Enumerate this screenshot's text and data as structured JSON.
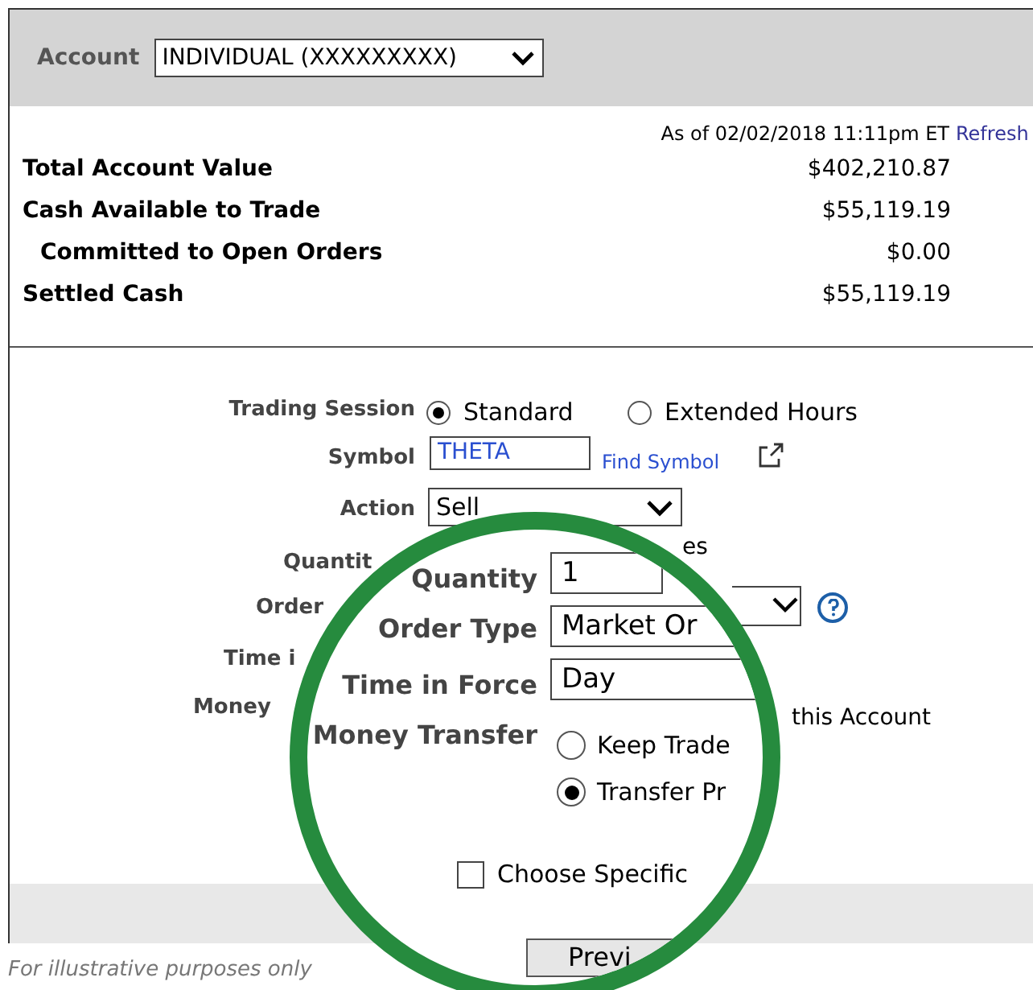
{
  "account": {
    "label": "Account",
    "value": "INDIVIDUAL (XXXXXXXXX)"
  },
  "balances": {
    "as_of": "As of 02/02/2018 11:11pm ET",
    "refresh": "Refresh",
    "rows": [
      {
        "label": "Total Account Value",
        "value": "$402,210.87",
        "indented": false
      },
      {
        "label": "Cash Available to Trade",
        "value": "$55,119.19",
        "indented": false
      },
      {
        "label": "Committed to Open Orders",
        "value": "$0.00",
        "indented": true
      },
      {
        "label": "Settled Cash",
        "value": "$55,119.19",
        "indented": false
      }
    ]
  },
  "order_form": {
    "trading_session": {
      "label": "Trading Session",
      "options": [
        {
          "label": "Standard",
          "selected": true
        },
        {
          "label": "Extended Hours",
          "selected": false
        }
      ]
    },
    "symbol": {
      "label": "Symbol",
      "value": "THETA",
      "find_link": "Find Symbol"
    },
    "action": {
      "label": "Action",
      "value": "Sell"
    },
    "covered_labels": [
      "Quantit",
      "Order",
      "Time i",
      "Money"
    ],
    "quantity_unit": "es",
    "transfer_note": "this Account"
  },
  "magnifier": {
    "quantity": {
      "label": "Quantity",
      "value": "1"
    },
    "order_type": {
      "label": "Order Type",
      "value": "Market Or"
    },
    "time_in_force": {
      "label": "Time in Force",
      "value": "Day"
    },
    "money_transfer": {
      "label": "Money Transfer",
      "options": [
        {
          "label": "Keep Trade",
          "selected": false
        },
        {
          "label": "Transfer Pr",
          "selected": true
        }
      ]
    },
    "choose_specific": {
      "label": "Choose Specific",
      "checked": false
    },
    "preview_button": "Previ"
  },
  "caption": "For illustrative purposes only"
}
